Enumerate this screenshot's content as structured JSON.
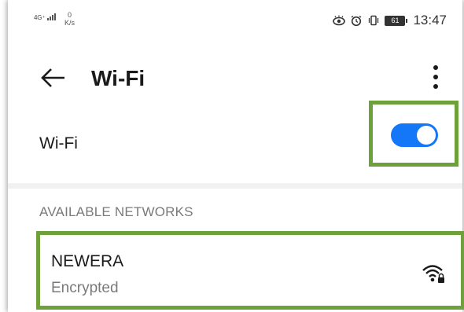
{
  "status_bar": {
    "network_type": "4G⁺",
    "speed_value": "0",
    "speed_unit": "K/s",
    "battery": "61",
    "time": "13:47"
  },
  "appbar": {
    "title": "Wi-Fi",
    "back_icon": "arrow-left-icon",
    "menu_icon": "more-vertical-icon"
  },
  "wifi_toggle": {
    "label": "Wi-Fi",
    "state": "on",
    "accent": "#1477f8"
  },
  "section": {
    "header": "AVAILABLE NETWORKS"
  },
  "networks": [
    {
      "name": "NEWERA",
      "status": "Encrypted",
      "icon": "wifi-lock-icon"
    }
  ],
  "highlight_color": "#6fa13a"
}
